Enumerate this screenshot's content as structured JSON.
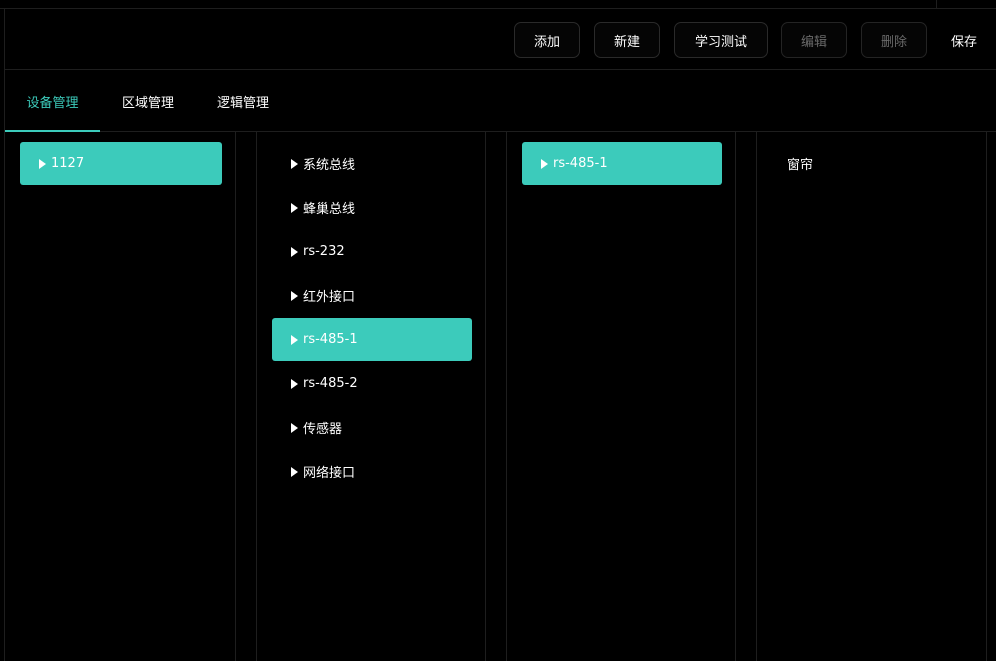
{
  "toolbar": {
    "add_label": "添加",
    "new_label": "新建",
    "learn_test_label": "学习测试",
    "edit_label": "编辑",
    "delete_label": "删除",
    "save_label": "保存"
  },
  "tabs": [
    {
      "label": "设备管理",
      "active": true
    },
    {
      "label": "区域管理",
      "active": false
    },
    {
      "label": "逻辑管理",
      "active": false
    }
  ],
  "columns": {
    "hosts": [
      {
        "label": "1127",
        "selected": true
      }
    ],
    "interfaces": [
      {
        "label": "系统总线",
        "selected": false
      },
      {
        "label": "蜂巢总线",
        "selected": false
      },
      {
        "label": "rs-232",
        "selected": false
      },
      {
        "label": "红外接口",
        "selected": false
      },
      {
        "label": "rs-485-1",
        "selected": true
      },
      {
        "label": "rs-485-2",
        "selected": false
      },
      {
        "label": "传感器",
        "selected": false
      },
      {
        "label": "网络接口",
        "selected": false
      }
    ],
    "buses": [
      {
        "label": "rs-485-1",
        "selected": true
      }
    ],
    "devices": [
      {
        "label": "窗帘"
      }
    ]
  },
  "colors": {
    "accent": "#3ccbbb",
    "background": "#000000",
    "border": "#1e1e1e",
    "disabled_text": "#6a6a6a"
  },
  "icons": {
    "expand": "caret-right-icon"
  }
}
